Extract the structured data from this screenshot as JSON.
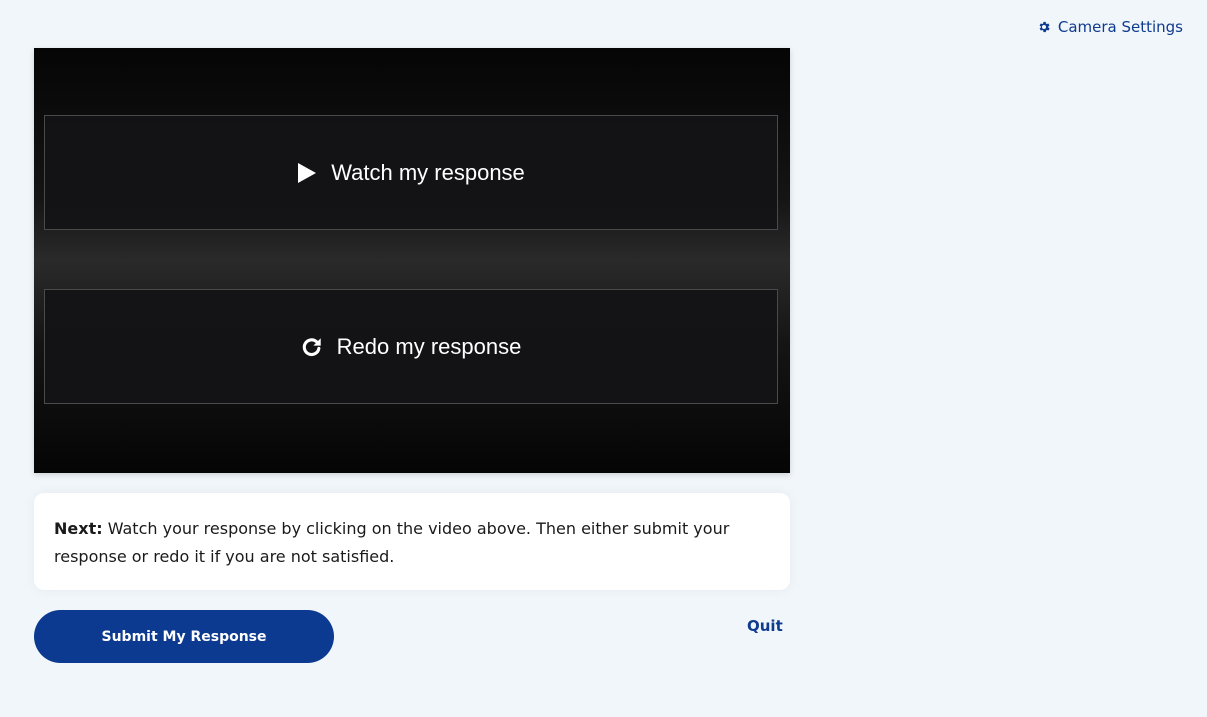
{
  "header": {
    "camera_settings_label": "Camera Settings",
    "camera_settings_icon": "gear-icon"
  },
  "video": {
    "watch_label": "Watch my response",
    "watch_icon": "play-icon",
    "redo_label": "Redo my response",
    "redo_icon": "redo-icon"
  },
  "instructions": {
    "lead": "Next:",
    "text": " Watch your response by clicking on the video above. Then either submit your response or redo it if you are not satisfied."
  },
  "actions": {
    "submit_label": "Submit My Response",
    "quit_label": "Quit"
  },
  "colors": {
    "accent": "#0d3a91",
    "background": "#f1f6fb"
  }
}
